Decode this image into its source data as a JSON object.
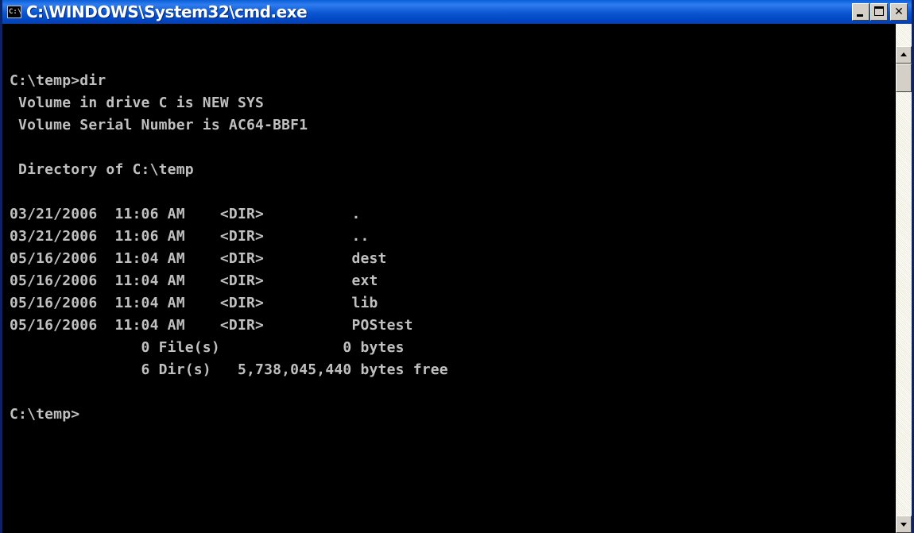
{
  "window": {
    "title": "C:\\WINDOWS\\System32\\cmd.exe",
    "icon_text": "C:\\",
    "icon": "console-icon",
    "controls": {
      "minimize": "minimize-icon",
      "maximize": "maximize-icon",
      "close": "close-icon",
      "close_glyph": "✕"
    }
  },
  "console": {
    "text_color": "#c0c0c0",
    "background": "#000000",
    "lines": [
      "C:\\temp>dir",
      " Volume in drive C is NEW SYS",
      " Volume Serial Number is AC64-BBF1",
      "",
      " Directory of C:\\temp",
      "",
      "03/21/2006  11:06 AM    <DIR>          .",
      "03/21/2006  11:06 AM    <DIR>          ..",
      "05/16/2006  11:04 AM    <DIR>          dest",
      "05/16/2006  11:04 AM    <DIR>          ext",
      "05/16/2006  11:04 AM    <DIR>          lib",
      "05/16/2006  11:04 AM    <DIR>          POStest",
      "               0 File(s)              0 bytes",
      "               6 Dir(s)   5,738,045,440 bytes free",
      "",
      "C:\\temp>"
    ]
  },
  "scrollbar": {
    "up": "arrow-up-icon",
    "down": "arrow-down-icon"
  }
}
